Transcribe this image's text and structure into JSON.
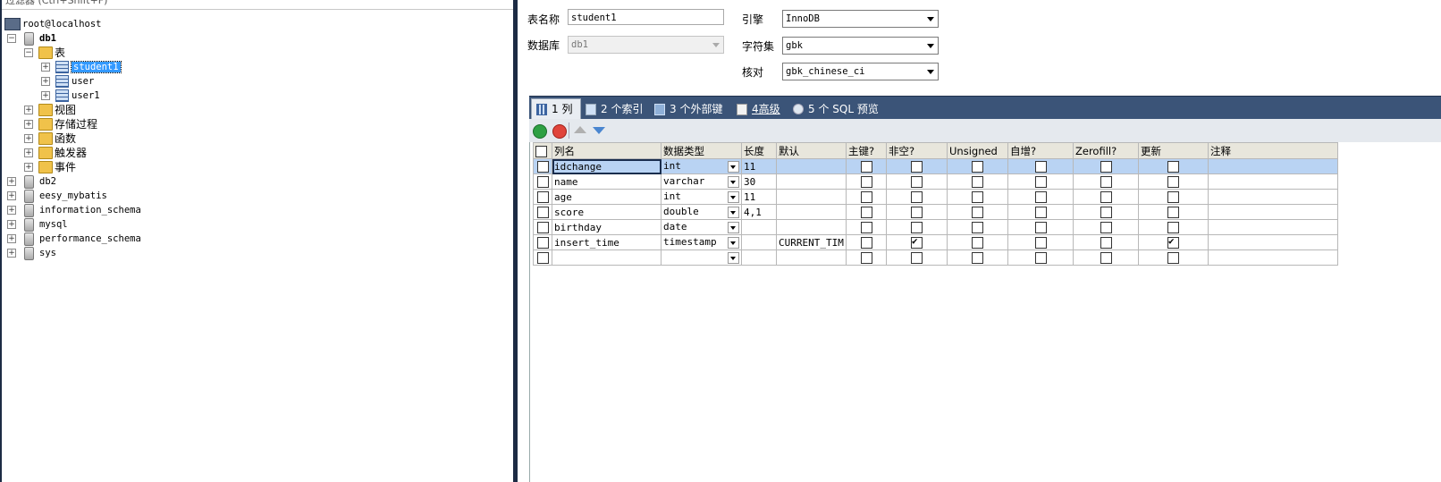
{
  "left": {
    "filter_placeholder": "过滤器 (Ctrl+Shift+F)",
    "connection": "root@localhost",
    "tree": [
      {
        "label": "db1",
        "kind": "db",
        "expanded": true
      },
      {
        "label": "表",
        "kind": "folder",
        "expanded": true
      },
      {
        "label": "student1",
        "kind": "table",
        "selected": true
      },
      {
        "label": "user",
        "kind": "table"
      },
      {
        "label": "user1",
        "kind": "table"
      },
      {
        "label": "视图",
        "kind": "folder"
      },
      {
        "label": "存储过程",
        "kind": "folder"
      },
      {
        "label": "函数",
        "kind": "folder"
      },
      {
        "label": "触发器",
        "kind": "folder"
      },
      {
        "label": "事件",
        "kind": "folder"
      },
      {
        "label": "db2",
        "kind": "db"
      },
      {
        "label": "eesy_mybatis",
        "kind": "db"
      },
      {
        "label": "information_schema",
        "kind": "db"
      },
      {
        "label": "mysql",
        "kind": "db"
      },
      {
        "label": "performance_schema",
        "kind": "db"
      },
      {
        "label": "sys",
        "kind": "db"
      }
    ]
  },
  "form": {
    "table_name_label": "表名称",
    "table_name_value": "student1",
    "database_label": "数据库",
    "database_value": "db1",
    "engine_label": "引擎",
    "engine_value": "InnoDB",
    "charset_label": "字符集",
    "charset_value": "gbk",
    "collation_label": "核对",
    "collation_value": "gbk_chinese_ci"
  },
  "tabs": [
    {
      "label": "1 列",
      "active": true
    },
    {
      "label": "2 个索引"
    },
    {
      "label": "3 个外部键"
    },
    {
      "label": "4高级"
    },
    {
      "label": "5 个 SQL 预览"
    }
  ],
  "grid": {
    "headers": [
      "列名",
      "数据类型",
      "长度",
      "默认",
      "主键?",
      "非空?",
      "Unsigned",
      "自增?",
      "Zerofill?",
      "更新",
      "注释"
    ],
    "rows": [
      {
        "name": "idchange",
        "type": "int",
        "length": "11",
        "default": "",
        "pk": false,
        "notnull": false,
        "unsigned": false,
        "autoinc": false,
        "zerofill": false,
        "update": false,
        "comment": ""
      },
      {
        "name": "name",
        "type": "varchar",
        "length": "30",
        "default": "",
        "pk": false,
        "notnull": false,
        "unsigned": false,
        "autoinc": false,
        "zerofill": false,
        "update": false,
        "comment": ""
      },
      {
        "name": "age",
        "type": "int",
        "length": "11",
        "default": "",
        "pk": false,
        "notnull": false,
        "unsigned": false,
        "autoinc": false,
        "zerofill": false,
        "update": false,
        "comment": ""
      },
      {
        "name": "score",
        "type": "double",
        "length": "4,1",
        "default": "",
        "pk": false,
        "notnull": false,
        "unsigned": false,
        "autoinc": false,
        "zerofill": false,
        "update": false,
        "comment": ""
      },
      {
        "name": "birthday",
        "type": "date",
        "length": "",
        "default": "",
        "pk": false,
        "notnull": false,
        "unsigned": false,
        "autoinc": false,
        "zerofill": false,
        "update": false,
        "comment": ""
      },
      {
        "name": "insert_time",
        "type": "timestamp",
        "length": "",
        "default": "CURRENT_TIM",
        "pk": false,
        "notnull": true,
        "unsigned": false,
        "autoinc": false,
        "zerofill": false,
        "update": true,
        "comment": ""
      },
      {
        "name": "",
        "type": "",
        "length": "",
        "default": "",
        "pk": false,
        "notnull": false,
        "unsigned": false,
        "autoinc": false,
        "zerofill": false,
        "update": false,
        "comment": ""
      }
    ]
  },
  "colors": {
    "tab_bar": "#3b5478",
    "selection": "#3399ff",
    "row_selected": "#b9d3f3",
    "splitter": "#1c2b44"
  }
}
